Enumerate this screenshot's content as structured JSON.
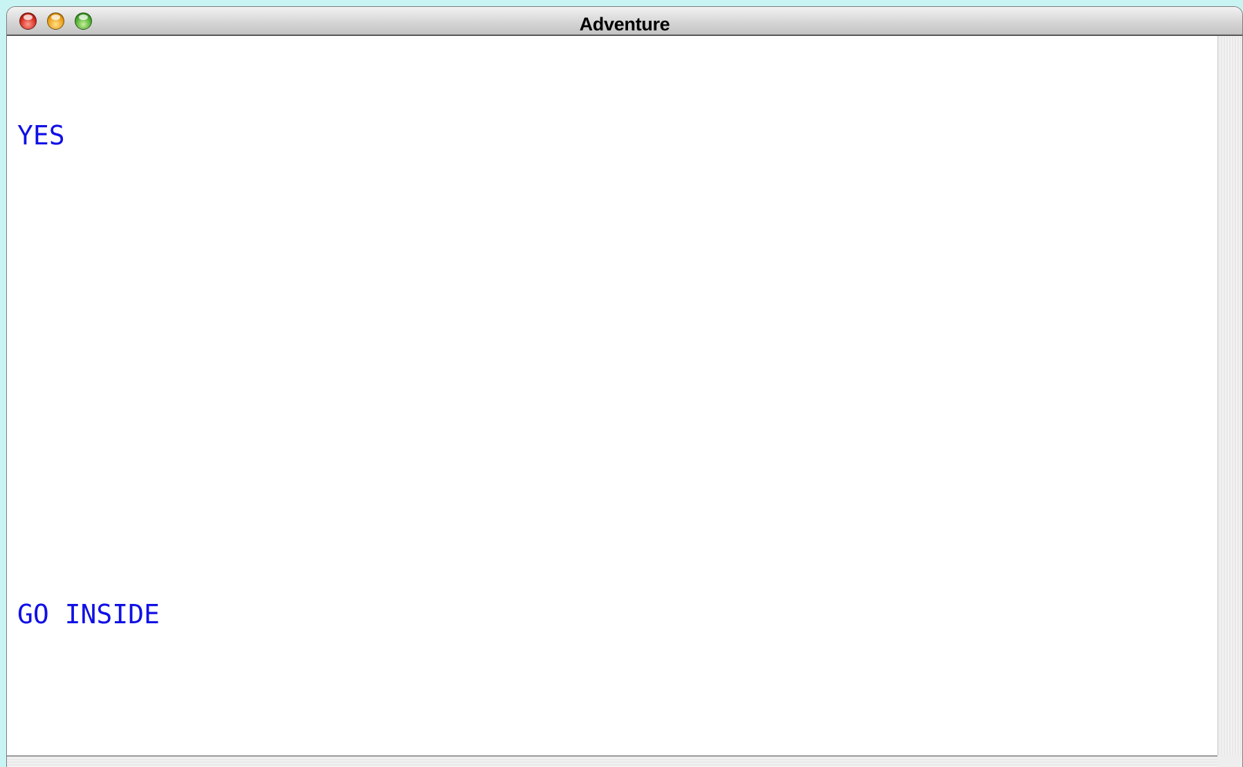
{
  "window": {
    "title": "Adventure"
  },
  "transcript": {
    "lines": [
      "YES",
      "GO INSIDE"
    ]
  },
  "colors": {
    "text": "#1010e6",
    "desktop": "#c8f5f3"
  },
  "icons": {
    "close": "close-icon",
    "minimize": "minimize-icon",
    "zoom": "zoom-icon"
  }
}
